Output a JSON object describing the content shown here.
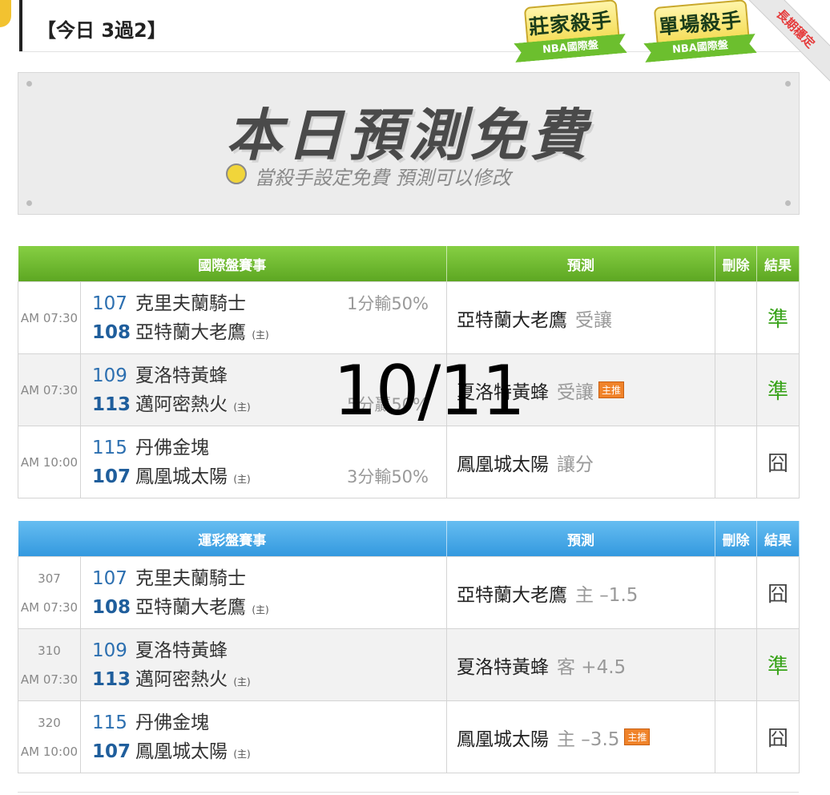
{
  "header": {
    "title": "【今日 3過2】",
    "badges": [
      {
        "name": "莊家殺手",
        "sub": "NBA國際盤"
      },
      {
        "name": "單場殺手",
        "sub": "NBA國際盤"
      }
    ],
    "corner_ribbon": "長期穩定"
  },
  "banner": {
    "title": "本日預測免費",
    "subtitle": "當殺手設定免費  預測可以修改"
  },
  "overlay_date": "10/11",
  "intl_table": {
    "headers": [
      "國際盤賽事",
      "預測",
      "刪除",
      "結果"
    ],
    "rows": [
      {
        "time": "AM 07:30",
        "team1_num": "107",
        "team1_name": "克里夫蘭騎士",
        "team1_home": "",
        "team2_num": "108",
        "team2_name": "亞特蘭大老鷹",
        "team2_home": "(主)",
        "handicap": "1分輸50%",
        "handicap_line": 1,
        "prediction": "亞特蘭大老鷹",
        "pred_extra": "受讓",
        "tag": "",
        "result": "準",
        "result_type": "good"
      },
      {
        "time": "AM 07:30",
        "team1_num": "109",
        "team1_name": "夏洛特黃蜂",
        "team1_home": "",
        "team2_num": "113",
        "team2_name": "邁阿密熱火",
        "team2_home": "(主)",
        "handicap": "5分贏50%",
        "handicap_line": 2,
        "prediction": "夏洛特黃蜂",
        "pred_extra": "受讓",
        "tag": "主推",
        "result": "準",
        "result_type": "good"
      },
      {
        "time": "AM 10:00",
        "team1_num": "115",
        "team1_name": "丹佛金塊",
        "team1_home": "",
        "team2_num": "107",
        "team2_name": "鳳凰城太陽",
        "team2_home": "(主)",
        "handicap": "3分輸50%",
        "handicap_line": 2,
        "prediction": "鳳凰城太陽",
        "pred_extra": "讓分",
        "tag": "",
        "result": "囧",
        "result_type": "bad"
      }
    ]
  },
  "sports_table": {
    "headers": [
      "運彩盤賽事",
      "預測",
      "刪除",
      "結果"
    ],
    "rows": [
      {
        "code": "307",
        "time": "AM 07:30",
        "team1_num": "107",
        "team1_name": "克里夫蘭騎士",
        "team1_home": "",
        "team2_num": "108",
        "team2_name": "亞特蘭大老鷹",
        "team2_home": "(主)",
        "prediction": "亞特蘭大老鷹",
        "pred_extra": "主 –1.5",
        "tag": "",
        "result": "囧",
        "result_type": "bad"
      },
      {
        "code": "310",
        "time": "AM 07:30",
        "team1_num": "109",
        "team1_name": "夏洛特黃蜂",
        "team1_home": "",
        "team2_num": "113",
        "team2_name": "邁阿密熱火",
        "team2_home": "(主)",
        "prediction": "夏洛特黃蜂",
        "pred_extra": "客 +4.5",
        "tag": "",
        "result": "準",
        "result_type": "good"
      },
      {
        "code": "320",
        "time": "AM 10:00",
        "team1_num": "115",
        "team1_name": "丹佛金塊",
        "team1_home": "",
        "team2_num": "107",
        "team2_name": "鳳凰城太陽",
        "team2_home": "(主)",
        "prediction": "鳳凰城太陽",
        "pred_extra": "主 –3.5",
        "tag": "主推",
        "result": "囧",
        "result_type": "bad"
      }
    ]
  }
}
